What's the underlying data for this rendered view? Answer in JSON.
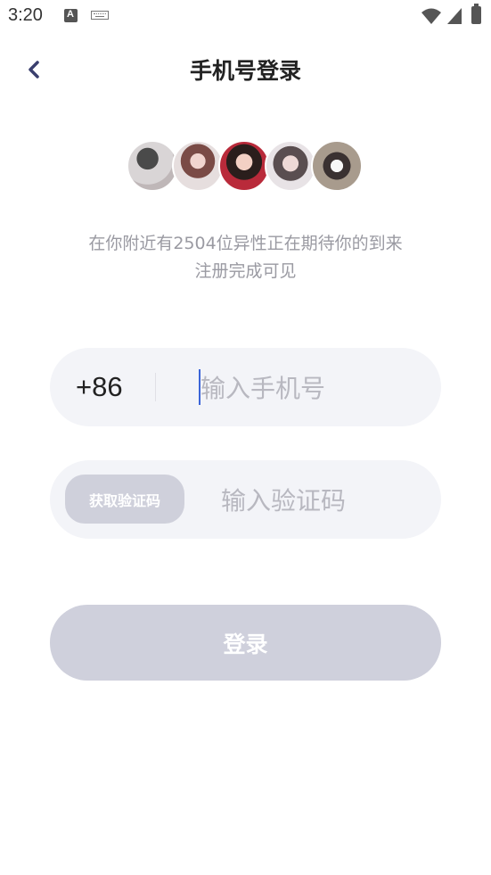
{
  "status_bar": {
    "time": "3:20"
  },
  "header": {
    "title": "手机号登录"
  },
  "promo": {
    "line1": "在你附近有2504位异性正在期待你的到来",
    "line2": "注册完成可见"
  },
  "phone": {
    "country_code": "+86",
    "placeholder": "输入手机号",
    "value": ""
  },
  "code": {
    "button_label": "获取验证码",
    "placeholder": "输入验证码",
    "value": ""
  },
  "login": {
    "label": "登录"
  },
  "colors": {
    "accent_cursor": "#3b64d8",
    "button_disabled": "#cfd0dc",
    "field_bg": "#f3f4f8"
  }
}
